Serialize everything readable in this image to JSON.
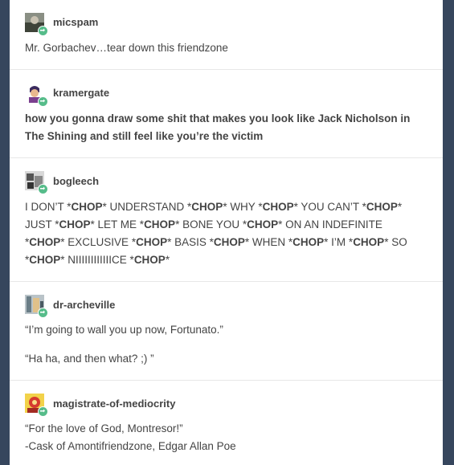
{
  "posts": [
    {
      "username": "micspam",
      "text": "Mr. Gorbachev…tear down this friendzone"
    },
    {
      "username": "kramergate",
      "lines": [
        "how you gonna draw some shit that makes you look like Jack Nicholson in",
        "The Shining and still feel like you’re the victim"
      ]
    },
    {
      "username": "bogleech",
      "segments": [
        [
          "I DON’T *",
          "CHOP",
          "* UNDERSTAND *",
          "CHOP",
          "* WHY *",
          "CHOP",
          "* YOU CAN’T *",
          "CHOP",
          "*"
        ],
        [
          "JUST *",
          "CHOP",
          "* LET ME *",
          "CHOP",
          "* BONE YOU *",
          "CHOP",
          "* ON AN INDEFINITE"
        ],
        [
          "*",
          "CHOP",
          "* EXCLUSIVE *",
          "CHOP",
          "* BASIS *",
          "CHOP",
          "* WHEN *",
          "CHOP",
          "* I’M *",
          "CHOP",
          "* SO"
        ],
        [
          "*",
          "CHOP",
          "* NIIIIIIIIIIIICE *",
          "CHOP",
          "*"
        ]
      ]
    },
    {
      "username": "dr-archeville",
      "paragraphs": [
        "“I’m going to wall you up now, Fortunato.”",
        "“Ha ha, and then what? ;) ”"
      ]
    },
    {
      "username": "magistrate-of-mediocrity",
      "lines": [
        "“For the love of God, Montresor!”",
        "-Cask of Amontifriendzone, Edgar Allan Poe"
      ]
    }
  ],
  "colors": {
    "background": "#36465d",
    "card": "#ffffff",
    "reblog_badge": "#56bc8a",
    "divider": "#e7e7e7"
  },
  "icons": {
    "reblog": "reblog-icon"
  }
}
